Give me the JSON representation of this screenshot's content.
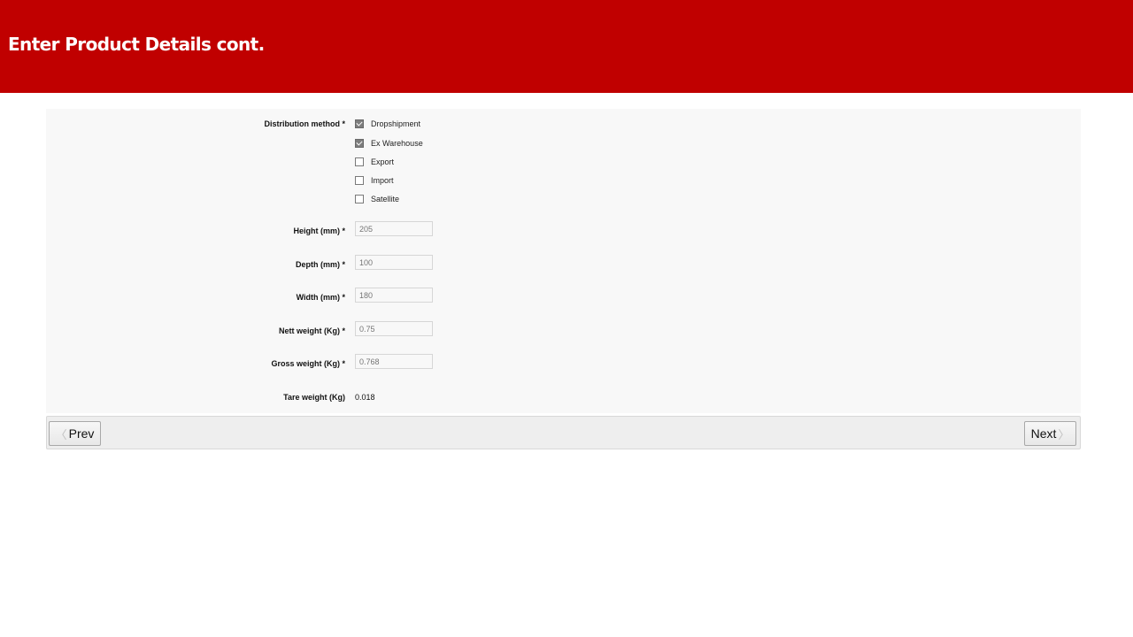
{
  "header": {
    "title": "Enter Product Details cont."
  },
  "form": {
    "distribution": {
      "label": "Distribution method *",
      "options": [
        {
          "label": "Dropshipment",
          "checked": true
        },
        {
          "label": "Ex Warehouse",
          "checked": true
        },
        {
          "label": "Export",
          "checked": false
        },
        {
          "label": "Import",
          "checked": false
        },
        {
          "label": "Satellite",
          "checked": false
        }
      ]
    },
    "height": {
      "label": "Height (mm) *",
      "placeholder": "205"
    },
    "depth": {
      "label": "Depth (mm) *",
      "placeholder": "100"
    },
    "width": {
      "label": "Width (mm) *",
      "placeholder": "180"
    },
    "nett_weight": {
      "label": "Nett weight (Kg) *",
      "placeholder": "0.75"
    },
    "gross_weight": {
      "label": "Gross weight (Kg) *",
      "placeholder": "0.768"
    },
    "tare_weight": {
      "label": "Tare weight (Kg)",
      "value": "0.018"
    }
  },
  "nav": {
    "prev_label": "Prev",
    "next_label": "Next",
    "prev_icon": "chevron-left-icon",
    "next_icon": "chevron-right-icon"
  }
}
